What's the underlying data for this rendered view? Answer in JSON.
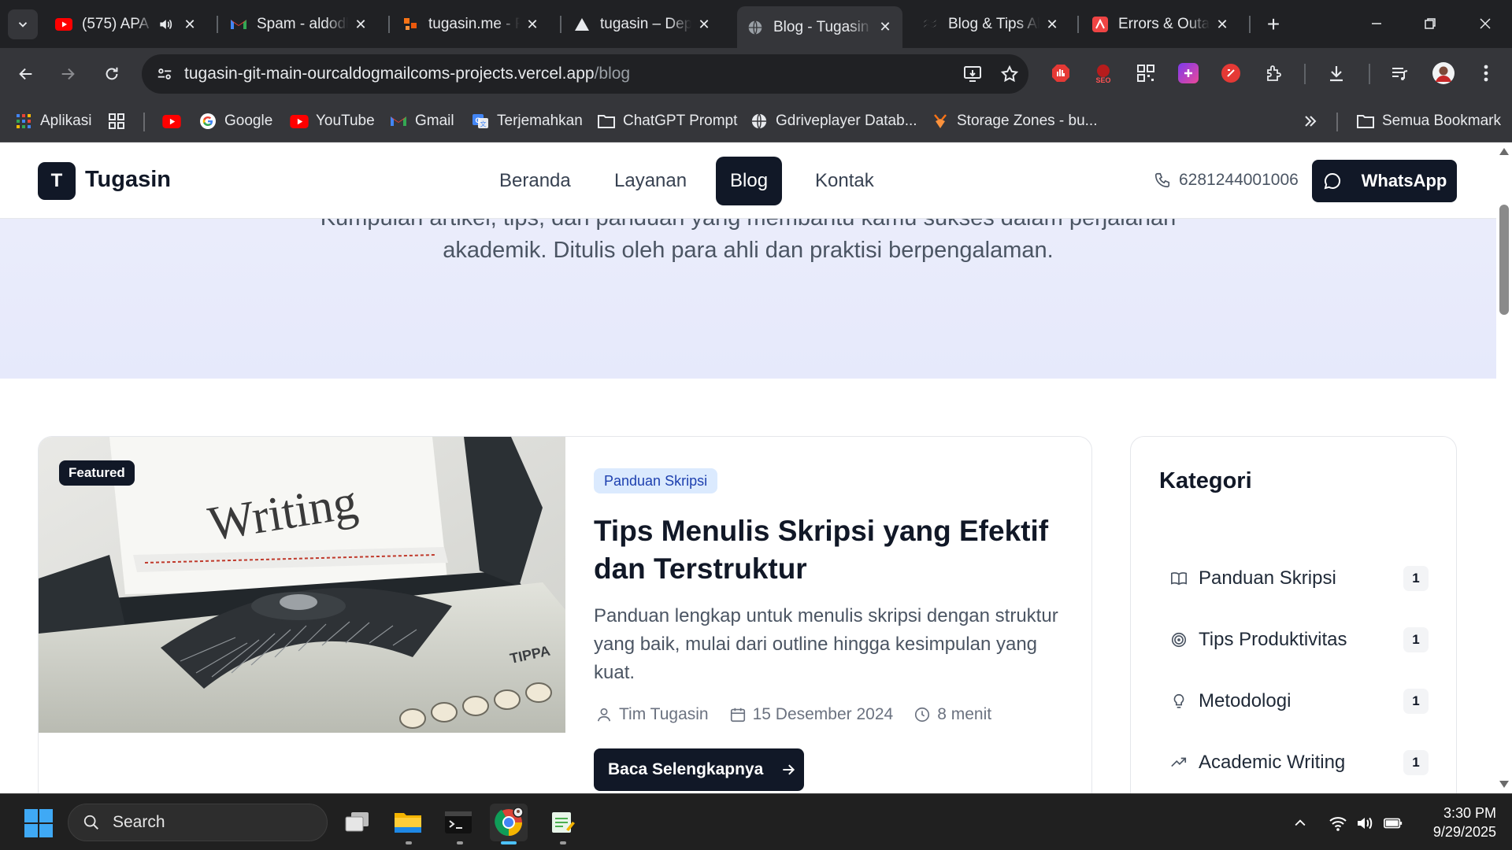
{
  "browser": {
    "tabs": [
      {
        "title": "(575) APA",
        "icon": "youtube-icon",
        "audio": true
      },
      {
        "title": "Spam - aldodl",
        "icon": "gmail-icon"
      },
      {
        "title": "tugasin.me - R",
        "icon": "tugasin-icon"
      },
      {
        "title": "tugasin – Depl",
        "icon": "vercel-icon"
      },
      {
        "title": "Blog - Tugasin",
        "icon": "globe-icon",
        "active": true
      },
      {
        "title": "Blog & Tips Al",
        "icon": "tailwind-icon"
      },
      {
        "title": "Errors & Outa",
        "icon": "errors-icon"
      }
    ],
    "address": {
      "host": "tugasin-git-main-ourcaldogmailcoms-projects.vercel.app",
      "path": "/blog"
    },
    "bookmarks": [
      {
        "label": "Aplikasi",
        "icon": "apps-grid-icon"
      },
      {
        "label": "",
        "icon": "grid-icon"
      },
      {
        "label": "",
        "icon": "youtube-icon"
      },
      {
        "label": "Google",
        "icon": "google-icon"
      },
      {
        "label": "YouTube",
        "icon": "youtube-icon"
      },
      {
        "label": "Gmail",
        "icon": "gmail-icon"
      },
      {
        "label": "Terjemahkan",
        "icon": "translate-icon"
      },
      {
        "label": "ChatGPT Prompt",
        "icon": "folder-icon"
      },
      {
        "label": "Gdriveplayer Datab...",
        "icon": "globe-icon"
      },
      {
        "label": "Storage Zones - bu...",
        "icon": "bunny-icon"
      }
    ],
    "all_bookmarks": "Semua Bookmark"
  },
  "site": {
    "logo_letter": "T",
    "brand": "Tugasin",
    "nav": [
      {
        "label": "Beranda",
        "active": false
      },
      {
        "label": "Layanan",
        "active": false
      },
      {
        "label": "Blog",
        "active": true
      },
      {
        "label": "Kontak",
        "active": false
      }
    ],
    "phone": "6281244001006",
    "whatsapp_label": "WhatsApp"
  },
  "hero": {
    "line1": "Kumpulan artikel, tips, dan panduan yang membantu kamu sukses dalam perjalanan",
    "line2": "akademik. Ditulis oleh para ahli dan praktisi berpengalaman."
  },
  "featured": {
    "badge": "Featured",
    "image_text": "Writing",
    "category": "Panduan Skripsi",
    "title": "Tips Menulis Skripsi yang Efektif dan Terstruktur",
    "excerpt": "Panduan lengkap untuk menulis skripsi dengan struktur yang baik, mulai dari outline hingga kesimpulan yang kuat.",
    "author": "Tim Tugasin",
    "date": "15 Desember 2024",
    "read_time": "8 menit",
    "cta": "Baca Selengkapnya"
  },
  "sidebar": {
    "title": "Kategori",
    "categories": [
      {
        "label": "Panduan Skripsi",
        "count": "1",
        "icon": "book-icon"
      },
      {
        "label": "Tips Produktivitas",
        "count": "1",
        "icon": "target-icon"
      },
      {
        "label": "Metodologi",
        "count": "1",
        "icon": "lightbulb-icon"
      },
      {
        "label": "Academic Writing",
        "count": "1",
        "icon": "trending-up-icon"
      }
    ]
  },
  "taskbar": {
    "search_label": "Search",
    "time": "3:30 PM",
    "date": "9/29/2025"
  }
}
